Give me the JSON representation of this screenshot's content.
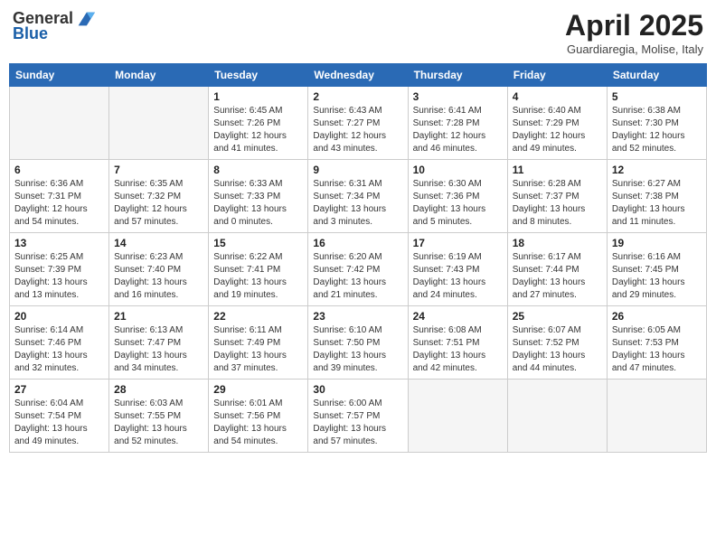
{
  "header": {
    "logo_general": "General",
    "logo_blue": "Blue",
    "month_title": "April 2025",
    "subtitle": "Guardiaregia, Molise, Italy"
  },
  "calendar": {
    "days_of_week": [
      "Sunday",
      "Monday",
      "Tuesday",
      "Wednesday",
      "Thursday",
      "Friday",
      "Saturday"
    ],
    "weeks": [
      [
        {
          "day": "",
          "info": ""
        },
        {
          "day": "",
          "info": ""
        },
        {
          "day": "1",
          "info": "Sunrise: 6:45 AM\nSunset: 7:26 PM\nDaylight: 12 hours and 41 minutes."
        },
        {
          "day": "2",
          "info": "Sunrise: 6:43 AM\nSunset: 7:27 PM\nDaylight: 12 hours and 43 minutes."
        },
        {
          "day": "3",
          "info": "Sunrise: 6:41 AM\nSunset: 7:28 PM\nDaylight: 12 hours and 46 minutes."
        },
        {
          "day": "4",
          "info": "Sunrise: 6:40 AM\nSunset: 7:29 PM\nDaylight: 12 hours and 49 minutes."
        },
        {
          "day": "5",
          "info": "Sunrise: 6:38 AM\nSunset: 7:30 PM\nDaylight: 12 hours and 52 minutes."
        }
      ],
      [
        {
          "day": "6",
          "info": "Sunrise: 6:36 AM\nSunset: 7:31 PM\nDaylight: 12 hours and 54 minutes."
        },
        {
          "day": "7",
          "info": "Sunrise: 6:35 AM\nSunset: 7:32 PM\nDaylight: 12 hours and 57 minutes."
        },
        {
          "day": "8",
          "info": "Sunrise: 6:33 AM\nSunset: 7:33 PM\nDaylight: 13 hours and 0 minutes."
        },
        {
          "day": "9",
          "info": "Sunrise: 6:31 AM\nSunset: 7:34 PM\nDaylight: 13 hours and 3 minutes."
        },
        {
          "day": "10",
          "info": "Sunrise: 6:30 AM\nSunset: 7:36 PM\nDaylight: 13 hours and 5 minutes."
        },
        {
          "day": "11",
          "info": "Sunrise: 6:28 AM\nSunset: 7:37 PM\nDaylight: 13 hours and 8 minutes."
        },
        {
          "day": "12",
          "info": "Sunrise: 6:27 AM\nSunset: 7:38 PM\nDaylight: 13 hours and 11 minutes."
        }
      ],
      [
        {
          "day": "13",
          "info": "Sunrise: 6:25 AM\nSunset: 7:39 PM\nDaylight: 13 hours and 13 minutes."
        },
        {
          "day": "14",
          "info": "Sunrise: 6:23 AM\nSunset: 7:40 PM\nDaylight: 13 hours and 16 minutes."
        },
        {
          "day": "15",
          "info": "Sunrise: 6:22 AM\nSunset: 7:41 PM\nDaylight: 13 hours and 19 minutes."
        },
        {
          "day": "16",
          "info": "Sunrise: 6:20 AM\nSunset: 7:42 PM\nDaylight: 13 hours and 21 minutes."
        },
        {
          "day": "17",
          "info": "Sunrise: 6:19 AM\nSunset: 7:43 PM\nDaylight: 13 hours and 24 minutes."
        },
        {
          "day": "18",
          "info": "Sunrise: 6:17 AM\nSunset: 7:44 PM\nDaylight: 13 hours and 27 minutes."
        },
        {
          "day": "19",
          "info": "Sunrise: 6:16 AM\nSunset: 7:45 PM\nDaylight: 13 hours and 29 minutes."
        }
      ],
      [
        {
          "day": "20",
          "info": "Sunrise: 6:14 AM\nSunset: 7:46 PM\nDaylight: 13 hours and 32 minutes."
        },
        {
          "day": "21",
          "info": "Sunrise: 6:13 AM\nSunset: 7:47 PM\nDaylight: 13 hours and 34 minutes."
        },
        {
          "day": "22",
          "info": "Sunrise: 6:11 AM\nSunset: 7:49 PM\nDaylight: 13 hours and 37 minutes."
        },
        {
          "day": "23",
          "info": "Sunrise: 6:10 AM\nSunset: 7:50 PM\nDaylight: 13 hours and 39 minutes."
        },
        {
          "day": "24",
          "info": "Sunrise: 6:08 AM\nSunset: 7:51 PM\nDaylight: 13 hours and 42 minutes."
        },
        {
          "day": "25",
          "info": "Sunrise: 6:07 AM\nSunset: 7:52 PM\nDaylight: 13 hours and 44 minutes."
        },
        {
          "day": "26",
          "info": "Sunrise: 6:05 AM\nSunset: 7:53 PM\nDaylight: 13 hours and 47 minutes."
        }
      ],
      [
        {
          "day": "27",
          "info": "Sunrise: 6:04 AM\nSunset: 7:54 PM\nDaylight: 13 hours and 49 minutes."
        },
        {
          "day": "28",
          "info": "Sunrise: 6:03 AM\nSunset: 7:55 PM\nDaylight: 13 hours and 52 minutes."
        },
        {
          "day": "29",
          "info": "Sunrise: 6:01 AM\nSunset: 7:56 PM\nDaylight: 13 hours and 54 minutes."
        },
        {
          "day": "30",
          "info": "Sunrise: 6:00 AM\nSunset: 7:57 PM\nDaylight: 13 hours and 57 minutes."
        },
        {
          "day": "",
          "info": ""
        },
        {
          "day": "",
          "info": ""
        },
        {
          "day": "",
          "info": ""
        }
      ]
    ]
  }
}
